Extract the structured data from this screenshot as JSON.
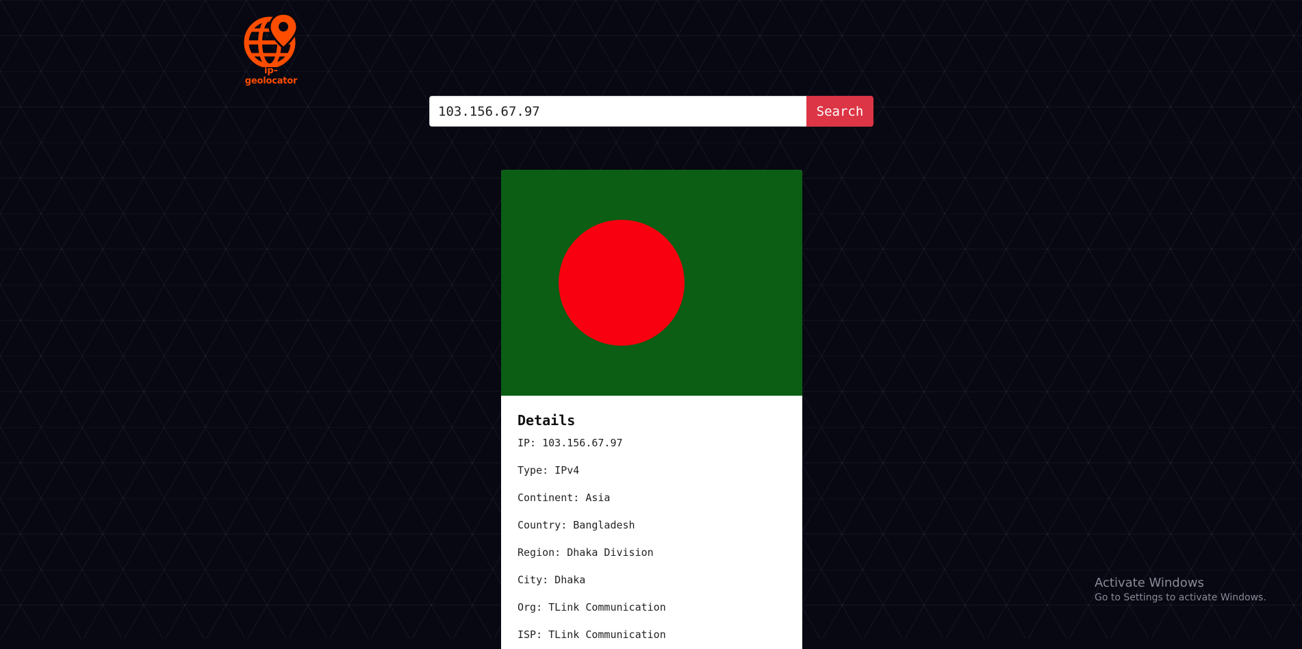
{
  "app": {
    "logo_text": "ip–geolocator",
    "brand_color": "#ff4d00"
  },
  "search": {
    "value": "103.156.67.97",
    "button_label": "Search",
    "button_color": "#dc3545"
  },
  "card": {
    "flag": {
      "country": "Bangladesh",
      "field_color": "#0b5e14",
      "disc_color": "#f8000f"
    },
    "title": "Details",
    "details": [
      "IP: 103.156.67.97",
      "Type: IPv4",
      "Continent: Asia",
      "Country: Bangladesh",
      "Region: Dhaka Division",
      "City: Dhaka",
      "Org: TLink Communication",
      "ISP: TLink Communication"
    ]
  },
  "watermark": {
    "title": "Activate Windows",
    "subtitle": "Go to Settings to activate Windows."
  },
  "icons": {
    "logo": "globe-pin-icon"
  }
}
